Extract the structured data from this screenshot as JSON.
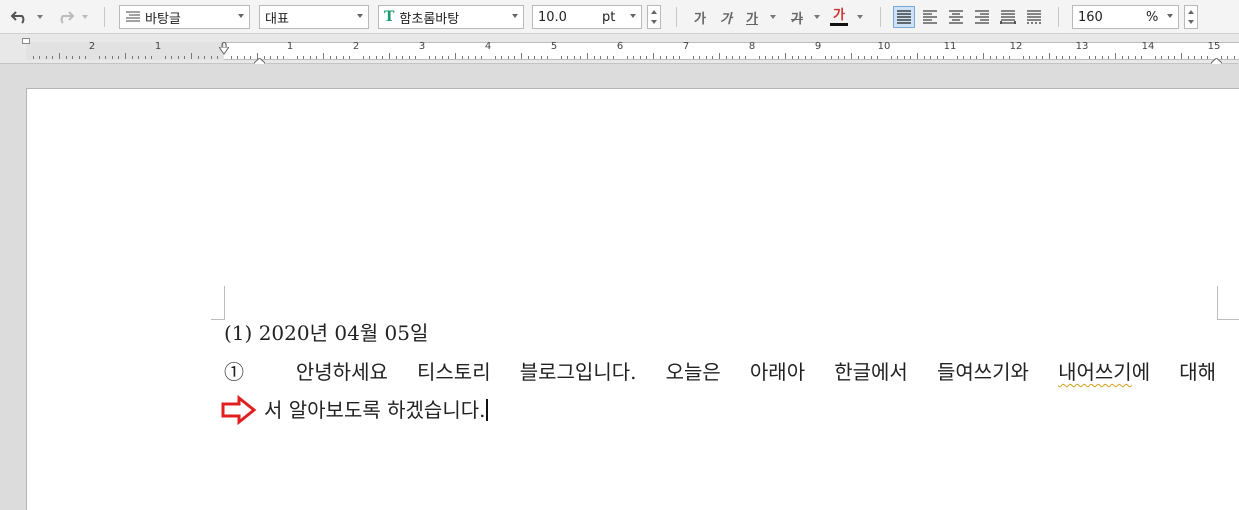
{
  "toolbar": {
    "style_name": "바탕글",
    "language": "대표",
    "font_name": "함초롬바탕",
    "font_icon_letter": "T",
    "font_size": "10.0",
    "font_unit": "pt",
    "bold_glyph": "가",
    "italic_glyph": "가",
    "underline_glyph": "가",
    "strike_glyph": "가",
    "color_glyph": "가",
    "zoom_value": "160",
    "zoom_unit": "%",
    "font_color": "#d33232"
  },
  "ruler": {
    "labels": [
      "2",
      "1",
      "0",
      "1",
      "2",
      "3",
      "4",
      "5",
      "6",
      "7",
      "8",
      "9",
      "10",
      "11",
      "12",
      "13",
      "14",
      "15"
    ]
  },
  "document": {
    "line1": "(1) 2020년 04월 05일",
    "line2_before": "① 안녕하세요 티스토리 블로그입니다. 오늘은 아래아 한글에서 들여쓰기와 ",
    "line2_flagged": "내어쓰기",
    "line2_after": "에 대해",
    "line3": "서 알아보도록 하겠습니다."
  }
}
